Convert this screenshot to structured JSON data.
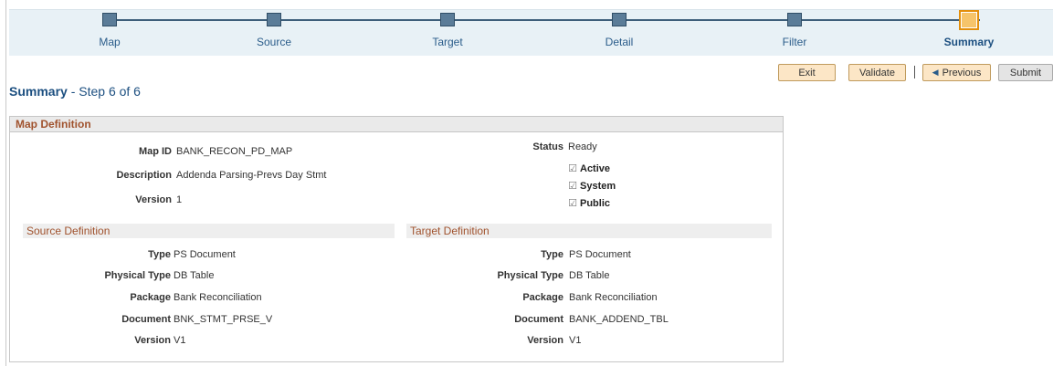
{
  "train": {
    "steps": [
      {
        "label": "Map"
      },
      {
        "label": "Source"
      },
      {
        "label": "Target"
      },
      {
        "label": "Detail"
      },
      {
        "label": "Filter"
      },
      {
        "label": "Summary"
      }
    ],
    "current_index": 5
  },
  "buttons": {
    "exit": "Exit",
    "validate": "Validate",
    "separator": "|",
    "previous": "Previous",
    "submit": "Submit"
  },
  "page": {
    "title_bold": "Summary",
    "title_rest": " - Step 6 of 6"
  },
  "map_definition": {
    "header": "Map Definition",
    "map_id_label": "Map ID",
    "map_id": "BANK_RECON_PD_MAP",
    "description_label": "Description",
    "description": "Addenda Parsing-Prevs Day Stmt",
    "version_label": "Version",
    "version": "1",
    "status_label": "Status",
    "status": "Ready",
    "checkboxes": [
      {
        "label": "Active",
        "checked": true
      },
      {
        "label": "System",
        "checked": true
      },
      {
        "label": "Public",
        "checked": true
      }
    ]
  },
  "source_definition": {
    "header": "Source Definition",
    "type_label": "Type",
    "type": "PS Document",
    "physical_type_label": "Physical Type",
    "physical_type": "DB Table",
    "package_label": "Package",
    "package": "Bank Reconciliation",
    "document_label": "Document",
    "document": "BNK_STMT_PRSE_V",
    "version_label": "Version",
    "version": "V1"
  },
  "target_definition": {
    "header": "Target Definition",
    "type_label": "Type",
    "type": "PS Document",
    "physical_type_label": "Physical Type",
    "physical_type": "DB Table",
    "package_label": "Package",
    "package": "Bank Reconciliation",
    "document_label": "Document",
    "document": "BANK_ADDEND_TBL",
    "version_label": "Version",
    "version": "V1"
  },
  "colors": {
    "accent": "#1c4f80",
    "section_header": "#a0522d",
    "current_step": "#f6c46a",
    "button_bg": "#fce6c6"
  }
}
